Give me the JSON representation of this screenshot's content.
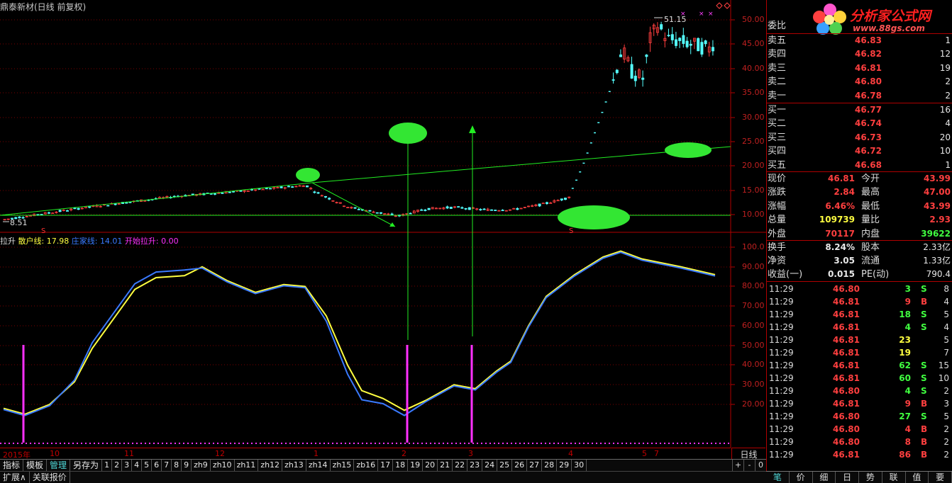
{
  "title": "鼎泰新材(日线 前复权)",
  "price_axis": [
    "50.00",
    "45.00",
    "40.00",
    "35.00",
    "30.00",
    "25.00",
    "20.00",
    "15.00",
    "10.00"
  ],
  "ind_axis": [
    "100.0",
    "90.00",
    "80.00",
    "70.00",
    "60.00",
    "50.00",
    "40.00",
    "30.00",
    "20.00"
  ],
  "chart_labels": {
    "high": "51.15",
    "low": "8.51",
    "s_marker": "S"
  },
  "indicator": {
    "name": "拉升",
    "retail_label": "散户线:",
    "retail_value": "17.98",
    "dealer_label": "庄家线:",
    "dealer_value": "14.01",
    "start_label": "开始拉升:",
    "start_value": "0.00"
  },
  "date_labels": [
    "2015年",
    "10",
    "11",
    "12",
    "1",
    "2",
    "3",
    "4",
    "5",
    "7"
  ],
  "period": "日线",
  "tabs": [
    "指标",
    "模板",
    "管理",
    "另存为",
    "1",
    "2",
    "3",
    "4",
    "5",
    "6",
    "7",
    "8",
    "9",
    "zh9",
    "zh10",
    "zh11",
    "zh12",
    "zh13",
    "zh14",
    "zh15",
    "zb16",
    "17",
    "18",
    "19",
    "20",
    "21",
    "22",
    "23",
    "24",
    "25",
    "26",
    "27",
    "28",
    "29",
    "30"
  ],
  "active_tab": "管理",
  "mini_buttons": [
    "+",
    "-",
    "0"
  ],
  "bottom_buttons": [
    "扩展∧",
    "关联报价"
  ],
  "logo": {
    "main": "分析家公式网",
    "url": "www.88gs.com"
  },
  "order_book": {
    "header": "委比",
    "asks": [
      {
        "label": "卖五",
        "price": "46.83",
        "vol": "1"
      },
      {
        "label": "卖四",
        "price": "46.82",
        "vol": "12"
      },
      {
        "label": "卖三",
        "price": "46.81",
        "vol": "19"
      },
      {
        "label": "卖二",
        "price": "46.80",
        "vol": "2"
      },
      {
        "label": "卖一",
        "price": "46.78",
        "vol": "2"
      }
    ],
    "bids": [
      {
        "label": "买一",
        "price": "46.77",
        "vol": "16"
      },
      {
        "label": "买二",
        "price": "46.74",
        "vol": "4"
      },
      {
        "label": "买三",
        "price": "46.73",
        "vol": "20"
      },
      {
        "label": "买四",
        "price": "46.72",
        "vol": "10"
      },
      {
        "label": "买五",
        "price": "46.68",
        "vol": "1"
      }
    ]
  },
  "quote": [
    {
      "l1": "现价",
      "v1": "46.81",
      "c1": "#ff3f3f",
      "l2": "今开",
      "v2": "43.99",
      "c2": "#ff3f3f"
    },
    {
      "l1": "涨跌",
      "v1": "2.84",
      "c1": "#ff3f3f",
      "l2": "最高",
      "v2": "47.00",
      "c2": "#ff3f3f"
    },
    {
      "l1": "涨幅",
      "v1": "6.46%",
      "c1": "#ff3f3f",
      "l2": "最低",
      "v2": "43.99",
      "c2": "#ff3f3f"
    },
    {
      "l1": "总量",
      "v1": "109739",
      "c1": "#ffff40",
      "l2": "量比",
      "v2": "2.93",
      "c2": "#ff3f3f"
    },
    {
      "l1": "外盘",
      "v1": "70117",
      "c1": "#ff3f3f",
      "l2": "内盘",
      "v2": "39622",
      "c2": "#40ff40"
    }
  ],
  "stats": [
    {
      "l1": "换手",
      "v1": "8.24%",
      "l2": "股本",
      "v2": "2.33亿"
    },
    {
      "l1": "净资",
      "v1": "3.05",
      "l2": "流通",
      "v2": "1.33亿"
    },
    {
      "l1": "收益(一)",
      "v1": "0.015",
      "l2": "PE(动)",
      "v2": "790.4"
    }
  ],
  "ticks": [
    {
      "t": "11:29",
      "p": "46.80",
      "v": "3",
      "f": "S",
      "n": "8"
    },
    {
      "t": "11:29",
      "p": "46.81",
      "v": "9",
      "f": "B",
      "n": "4"
    },
    {
      "t": "11:29",
      "p": "46.81",
      "v": "18",
      "f": "S",
      "n": "5"
    },
    {
      "t": "11:29",
      "p": "46.81",
      "v": "4",
      "f": "S",
      "n": "4"
    },
    {
      "t": "11:29",
      "p": "46.81",
      "v": "23",
      "f": "",
      "n": "5"
    },
    {
      "t": "11:29",
      "p": "46.81",
      "v": "19",
      "f": "",
      "n": "7"
    },
    {
      "t": "11:29",
      "p": "46.81",
      "v": "62",
      "f": "S",
      "n": "15"
    },
    {
      "t": "11:29",
      "p": "46.81",
      "v": "60",
      "f": "S",
      "n": "10"
    },
    {
      "t": "11:29",
      "p": "46.80",
      "v": "4",
      "f": "S",
      "n": "2"
    },
    {
      "t": "11:29",
      "p": "46.81",
      "v": "9",
      "f": "B",
      "n": "3"
    },
    {
      "t": "11:29",
      "p": "46.80",
      "v": "27",
      "f": "S",
      "n": "5"
    },
    {
      "t": "11:29",
      "p": "46.80",
      "v": "4",
      "f": "B",
      "n": "2"
    },
    {
      "t": "11:29",
      "p": "46.80",
      "v": "8",
      "f": "B",
      "n": "2"
    },
    {
      "t": "11:29",
      "p": "46.81",
      "v": "86",
      "f": "B",
      "n": "2"
    }
  ],
  "footer_tabs": [
    "笔",
    "价",
    "细",
    "日",
    "势",
    "联",
    "值",
    "要"
  ],
  "active_footer": "笔",
  "colors": {
    "up": "#ff3f3f",
    "down": "#54ffff",
    "retail": "#ffff40",
    "dealer": "#3a7aff",
    "signal": "#ff30ff",
    "annot": "#22ee22"
  }
}
